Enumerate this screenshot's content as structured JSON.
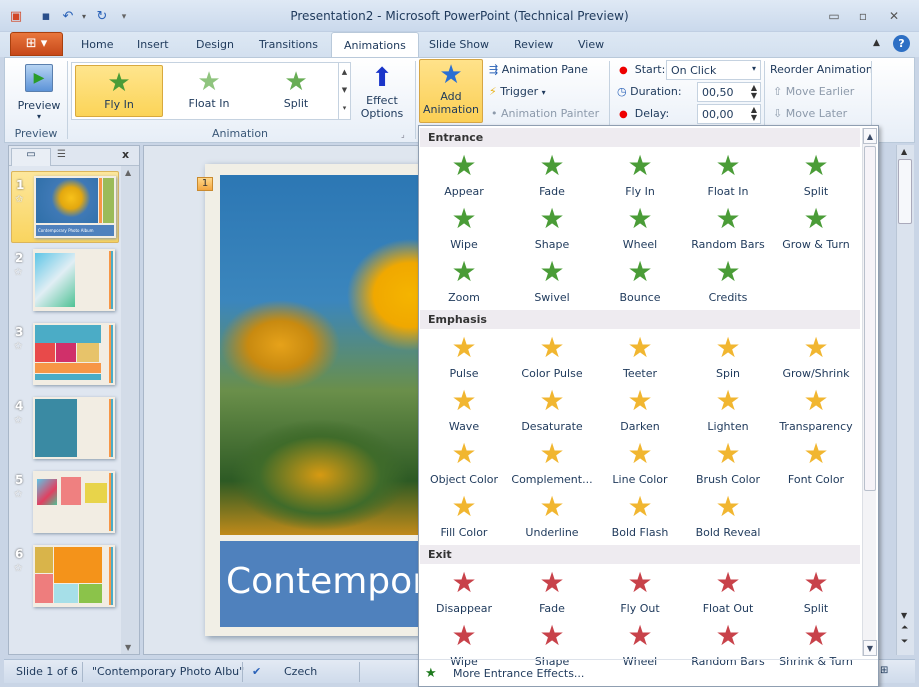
{
  "window": {
    "title": "Presentation2  -  Microsoft PowerPoint (Technical Preview)",
    "minimize_icon": "minimize-icon",
    "maximize_icon": "restore-icon",
    "close_icon": "close-icon"
  },
  "qat": {
    "icons": [
      "powerpoint-logo-icon",
      "save-icon",
      "undo-icon",
      "undo-dropdown-icon",
      "redo-icon",
      "customize-qat-icon"
    ]
  },
  "file_button": {
    "icon": "office-file-icon"
  },
  "tabs": [
    {
      "label": "Home"
    },
    {
      "label": "Insert"
    },
    {
      "label": "Design"
    },
    {
      "label": "Transitions"
    },
    {
      "label": "Animations",
      "active": true
    },
    {
      "label": "Slide Show"
    },
    {
      "label": "Review"
    },
    {
      "label": "View"
    }
  ],
  "ribbon": {
    "preview": {
      "button_label": "Preview",
      "group_label": "Preview"
    },
    "animation_gallery": {
      "items": [
        {
          "label": "Fly In",
          "selected": true
        },
        {
          "label": "Float In"
        },
        {
          "label": "Split"
        }
      ],
      "group_label": "Animation",
      "effect_options_label_1": "Effect",
      "effect_options_label_2": "Options"
    },
    "advanced": {
      "add_animation_1": "Add",
      "add_animation_2": "Animation",
      "animation_pane": "Animation Pane",
      "trigger": "Trigger",
      "animation_painter": "Animation Painter"
    },
    "timing": {
      "start_label": "Start:",
      "start_value": "On Click",
      "duration_label": "Duration:",
      "duration_value": "00,50",
      "delay_label": "Delay:",
      "delay_value": "00,00",
      "reorder_label": "Reorder Animation",
      "move_earlier": "Move Earlier",
      "move_later": "Move Later"
    }
  },
  "slides_pane": {
    "slides": [
      {
        "number": "1",
        "selected": true,
        "title": "Contemporary Photo Album"
      },
      {
        "number": "2"
      },
      {
        "number": "3"
      },
      {
        "number": "4"
      },
      {
        "number": "5"
      },
      {
        "number": "6"
      }
    ],
    "close_label": "x"
  },
  "slide": {
    "animation_tag": "1",
    "title_text": "Contemporary Photo Album"
  },
  "dropdown": {
    "sections": [
      {
        "title": "Entrance",
        "color": "#4a9c37",
        "effects": [
          "Appear",
          "Fade",
          "Fly In",
          "Float In",
          "Split",
          "Wipe",
          "Shape",
          "Wheel",
          "Random Bars",
          "Grow & Turn",
          "Zoom",
          "Swivel",
          "Bounce",
          "Credits"
        ]
      },
      {
        "title": "Emphasis",
        "color": "#f1b630",
        "effects": [
          "Pulse",
          "Color Pulse",
          "Teeter",
          "Spin",
          "Grow/Shrink",
          "Wave",
          "Desaturate",
          "Darken",
          "Lighten",
          "Transparency",
          "Object Color",
          "Complement...",
          "Line Color",
          "Brush Color",
          "Font Color",
          "Fill Color",
          "Underline",
          "Bold Flash",
          "Bold Reveal"
        ]
      },
      {
        "title": "Exit",
        "color": "#c8424a",
        "effects": [
          "Disappear",
          "Fade",
          "Fly Out",
          "Float Out",
          "Split",
          "Wipe",
          "Shape",
          "Wheel",
          "Random Bars",
          "Shrink & Turn"
        ]
      }
    ],
    "more_entrance": "More Entrance Effects..."
  },
  "statusbar": {
    "slide_info": "Slide 1 of 6",
    "theme": "\"Contemporary Photo Albu\"",
    "language": "Czech"
  }
}
